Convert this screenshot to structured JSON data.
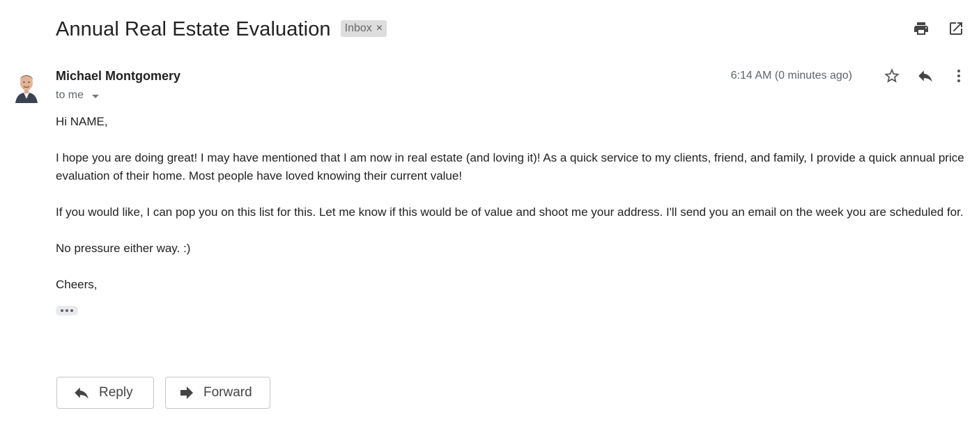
{
  "email": {
    "subject": "Annual Real Estate Evaluation",
    "label": "Inbox",
    "label_close": "×",
    "sender_name": "Michael Montgomery",
    "recipient": "to me",
    "timestamp": "6:14 AM (0 minutes ago)",
    "body": {
      "greeting": "Hi NAME,",
      "paragraph1": "I hope you are doing great! I may have mentioned that I am now in real estate (and loving it)! As a quick service to my clients, friend, and family, I provide a quick annual price evaluation of their home. Most people have loved knowing their current value!",
      "paragraph2": "If you would like, I can pop you on this list for this. Let me know if this would be of value and shoot me your address. I'll send you an email on the week you are scheduled for.",
      "paragraph3": "No pressure either way. :)",
      "closing": "Cheers,"
    }
  },
  "footer": {
    "reply_label": "Reply",
    "forward_label": "Forward"
  },
  "icons": {
    "print": "printer-icon",
    "open_new_window": "open-in-new-icon",
    "star": "star-outline-icon",
    "reply": "reply-icon",
    "more": "more-vertical-icon",
    "forward": "forward-arrow-icon"
  },
  "colors": {
    "text": "#222222",
    "secondary_text": "#5f6368",
    "chip_bg": "#dddddd",
    "button_border": "#c6c6c6"
  }
}
